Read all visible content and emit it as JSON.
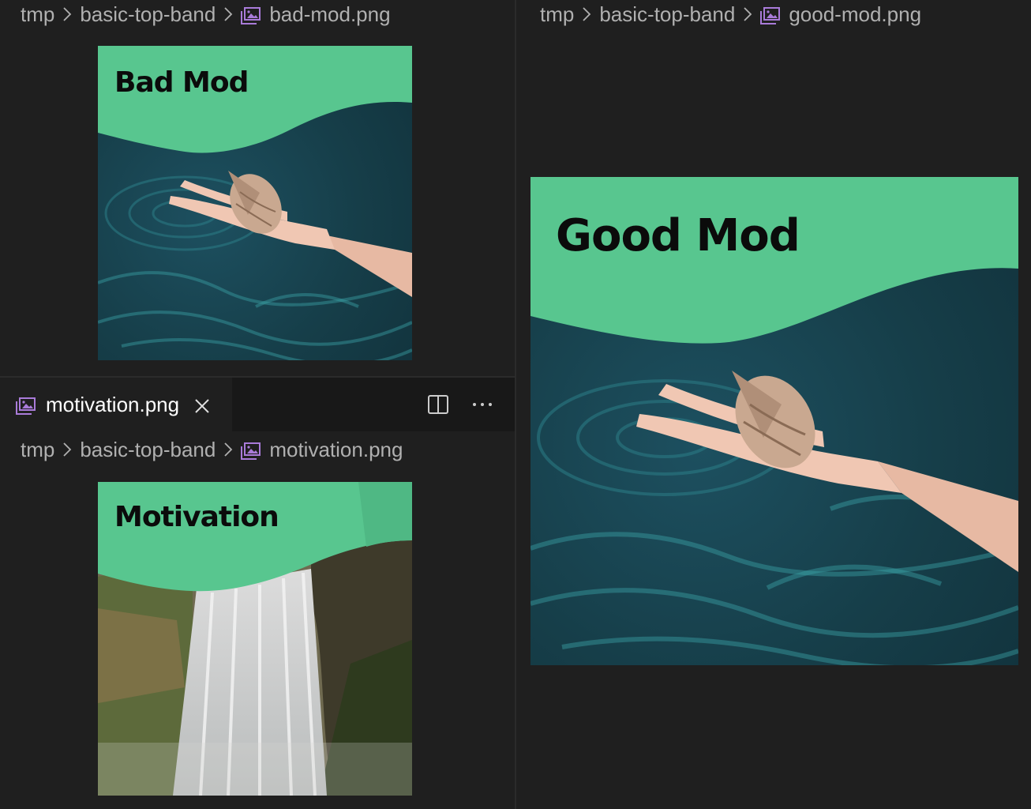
{
  "panes": {
    "top_left": {
      "breadcrumb": {
        "root": "tmp",
        "folder": "basic-top-band",
        "file": "bad-mod.png"
      },
      "image": {
        "title": "Bad Mod"
      }
    },
    "bottom_left": {
      "tab": {
        "label": "motivation.png"
      },
      "breadcrumb": {
        "root": "tmp",
        "folder": "basic-top-band",
        "file": "motivation.png"
      },
      "image": {
        "title": "Motivation"
      }
    },
    "right": {
      "breadcrumb": {
        "root": "tmp",
        "folder": "basic-top-band",
        "file": "good-mod.png"
      },
      "image": {
        "title": "Good Mod"
      }
    }
  },
  "icons": {
    "file": "image-file-icon",
    "separator": "chevron-right-icon",
    "close": "close-icon",
    "split": "split-editor-icon",
    "more": "more-actions-icon"
  },
  "colors": {
    "background": "#1f1f1f",
    "tabbar": "#181818",
    "band_green": "#58c68f",
    "water_dark": "#163e49",
    "water_light": "#2f8088",
    "icon_purple": "#a97bd9"
  }
}
